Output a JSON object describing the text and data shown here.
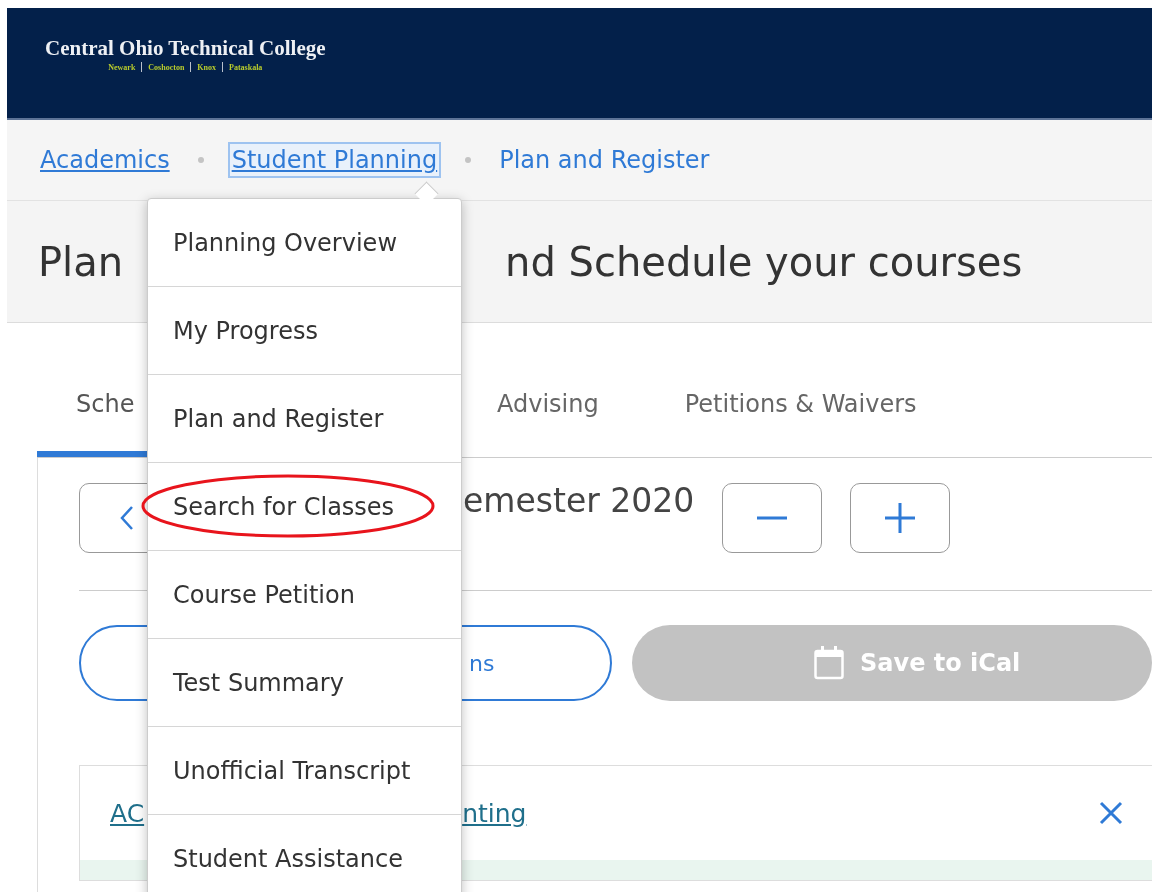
{
  "header": {
    "college_name": "Central Ohio Technical College",
    "campuses": [
      "Newark",
      "Coshocton",
      "Knox",
      "Pataskala"
    ]
  },
  "breadcrumbs": [
    {
      "label": "Academics",
      "current": false,
      "expanded": false
    },
    {
      "label": "Student Planning",
      "current": false,
      "expanded": true
    },
    {
      "label": "Plan and Register",
      "current": true,
      "expanded": false
    }
  ],
  "page_title": {
    "visible_start": "Plan",
    "visible_end": "nd Schedule your courses"
  },
  "tabs": [
    {
      "label": "Sche",
      "selected": true
    },
    {
      "label": "Advising",
      "selected": false
    },
    {
      "label": "Petitions & Waivers",
      "selected": false
    }
  ],
  "term": {
    "label": "emester 2020"
  },
  "actions": [
    {
      "label": "ns",
      "disabled": false
    },
    {
      "label": "Save to iCal",
      "disabled": true
    }
  ],
  "course_card": {
    "link_start": "AC",
    "link_end": "nting"
  },
  "dropdown_menu": {
    "items": [
      {
        "label": "Planning Overview",
        "highlighted": false
      },
      {
        "label": "My Progress",
        "highlighted": false
      },
      {
        "label": "Plan and Register",
        "highlighted": false
      },
      {
        "label": "Search for Classes",
        "highlighted": true
      },
      {
        "label": "Course Petition",
        "highlighted": false
      },
      {
        "label": "Test Summary",
        "highlighted": false
      },
      {
        "label": "Unofficial Transcript",
        "highlighted": false
      },
      {
        "label": "Student Assistance",
        "highlighted": false
      }
    ]
  }
}
